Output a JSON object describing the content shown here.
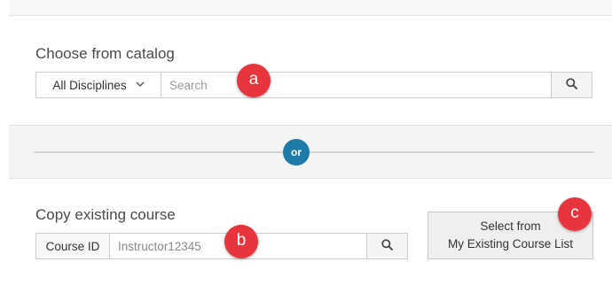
{
  "catalog": {
    "title": "Choose from catalog",
    "discipline_label": "All Disciplines",
    "search_placeholder": "Search"
  },
  "divider": {
    "label": "or"
  },
  "copy_course": {
    "title": "Copy existing course",
    "course_id_label": "Course ID",
    "course_id_value": "Instructor12345"
  },
  "select_button": {
    "line1": "Select from",
    "line2": "My Existing Course List"
  },
  "callouts": {
    "a": "a",
    "b": "b",
    "c": "c"
  },
  "colors": {
    "or_badge": "#1e7aa6",
    "callout": "#e8343d",
    "band": "#f4f4f4"
  },
  "icons": {
    "search": "search-icon",
    "chevron": "chevron-down-icon"
  }
}
